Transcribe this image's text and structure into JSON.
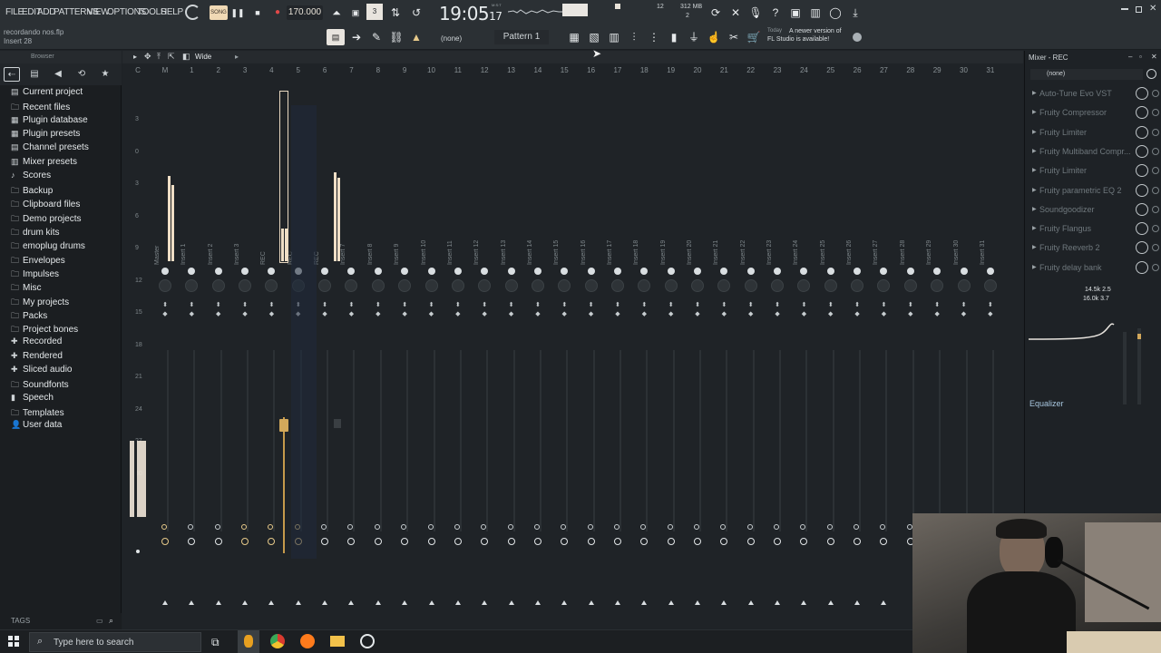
{
  "menu": [
    "FILE",
    "EDIT",
    "ADD",
    "PATTERNS",
    "VIEW",
    "OPTIONS",
    "TOOLS",
    "HELP"
  ],
  "transport": {
    "song_label": "SONG",
    "tempo": "170.000",
    "time": "19:05",
    "time_frac": "17",
    "time_unit": "M:S:T"
  },
  "cpu": {
    "cpu_value": "12",
    "mem_mb": "312 MB",
    "poly": "2"
  },
  "hint": {
    "file": "recordando nos.flp",
    "target": "Insert 28"
  },
  "toolbar2": {
    "preset_none": "(none)",
    "pattern": "Pattern 1",
    "news_today": "Today",
    "news_text1": "A newer version of",
    "news_text2": "FL Studio is available!"
  },
  "browser": {
    "title": "Browser",
    "items": [
      {
        "icon": "doc",
        "label": "Current project"
      },
      {
        "icon": "folder",
        "label": "Recent files"
      },
      {
        "icon": "plug",
        "label": "Plugin database"
      },
      {
        "icon": "plug",
        "label": "Plugin presets"
      },
      {
        "icon": "channel",
        "label": "Channel presets"
      },
      {
        "icon": "mixer",
        "label": "Mixer presets"
      },
      {
        "icon": "note",
        "label": "Scores"
      },
      {
        "icon": "folder",
        "label": "Backup"
      },
      {
        "icon": "folder",
        "label": "Clipboard files"
      },
      {
        "icon": "folder",
        "label": "Demo projects"
      },
      {
        "icon": "folder",
        "label": "drum kits"
      },
      {
        "icon": "folder",
        "label": "emoplug drums"
      },
      {
        "icon": "folder",
        "label": "Envelopes"
      },
      {
        "icon": "folder",
        "label": "Impulses"
      },
      {
        "icon": "folder",
        "label": "Misc"
      },
      {
        "icon": "folder",
        "label": "My projects"
      },
      {
        "icon": "folder",
        "label": "Packs"
      },
      {
        "icon": "folder",
        "label": "Project bones"
      },
      {
        "icon": "plus",
        "label": "Recorded"
      },
      {
        "icon": "plus",
        "label": "Rendered"
      },
      {
        "icon": "plus",
        "label": "Sliced audio"
      },
      {
        "icon": "folder",
        "label": "Soundfonts"
      },
      {
        "icon": "mic",
        "label": "Speech"
      },
      {
        "icon": "folder",
        "label": "Templates"
      },
      {
        "icon": "user",
        "label": "User data"
      }
    ],
    "tags_label": "TAGS"
  },
  "mixer": {
    "view": "Wide",
    "db_marks": [
      "3",
      "0",
      "3",
      "6",
      "9",
      "12",
      "15",
      "18",
      "21",
      "24",
      "27",
      "30"
    ],
    "columns": [
      "C",
      "M",
      "1",
      "2",
      "3",
      "4",
      "5",
      "6",
      "7",
      "8",
      "9",
      "10",
      "11",
      "12",
      "13",
      "14",
      "15",
      "16",
      "17",
      "18",
      "19",
      "20",
      "21",
      "22",
      "23",
      "24",
      "25",
      "26",
      "27",
      "28",
      "29",
      "30",
      "31"
    ],
    "strip_names": [
      "Master",
      "Insert 1",
      "Insert 2",
      "Insert 3",
      "REC",
      "REC",
      "REC",
      "Insert 7",
      "Insert 8",
      "Insert 9",
      "Insert 10",
      "Insert 11",
      "Insert 12",
      "Insert 13",
      "Insert 14",
      "Insert 15",
      "Insert 16",
      "Insert 17",
      "Insert 18",
      "Insert 19",
      "Insert 20",
      "Insert 21",
      "Insert 22",
      "Insert 23",
      "Insert 24",
      "Insert 25",
      "Insert 26",
      "Insert 27",
      "Insert 28",
      "Insert 29",
      "Insert 30",
      "Insert 31"
    ]
  },
  "mixer_rec": {
    "title": "Mixer - REC",
    "preset": "(none)",
    "slots": [
      "Auto-Tune Evo VST",
      "Fruity Compressor",
      "Fruity Limiter",
      "Fruity Multiband Compr...",
      "Fruity Limiter",
      "Fruity parametric EQ 2",
      "Soundgoodizer",
      "Fruity Flangus",
      "Fruity Reeverb 2",
      "Fruity delay bank"
    ],
    "eq_readout1": "14.5k 2.5",
    "eq_readout2": "16.0k 3.7",
    "eq_label": "Equalizer"
  },
  "taskbar": {
    "search_placeholder": "Type here to search"
  }
}
